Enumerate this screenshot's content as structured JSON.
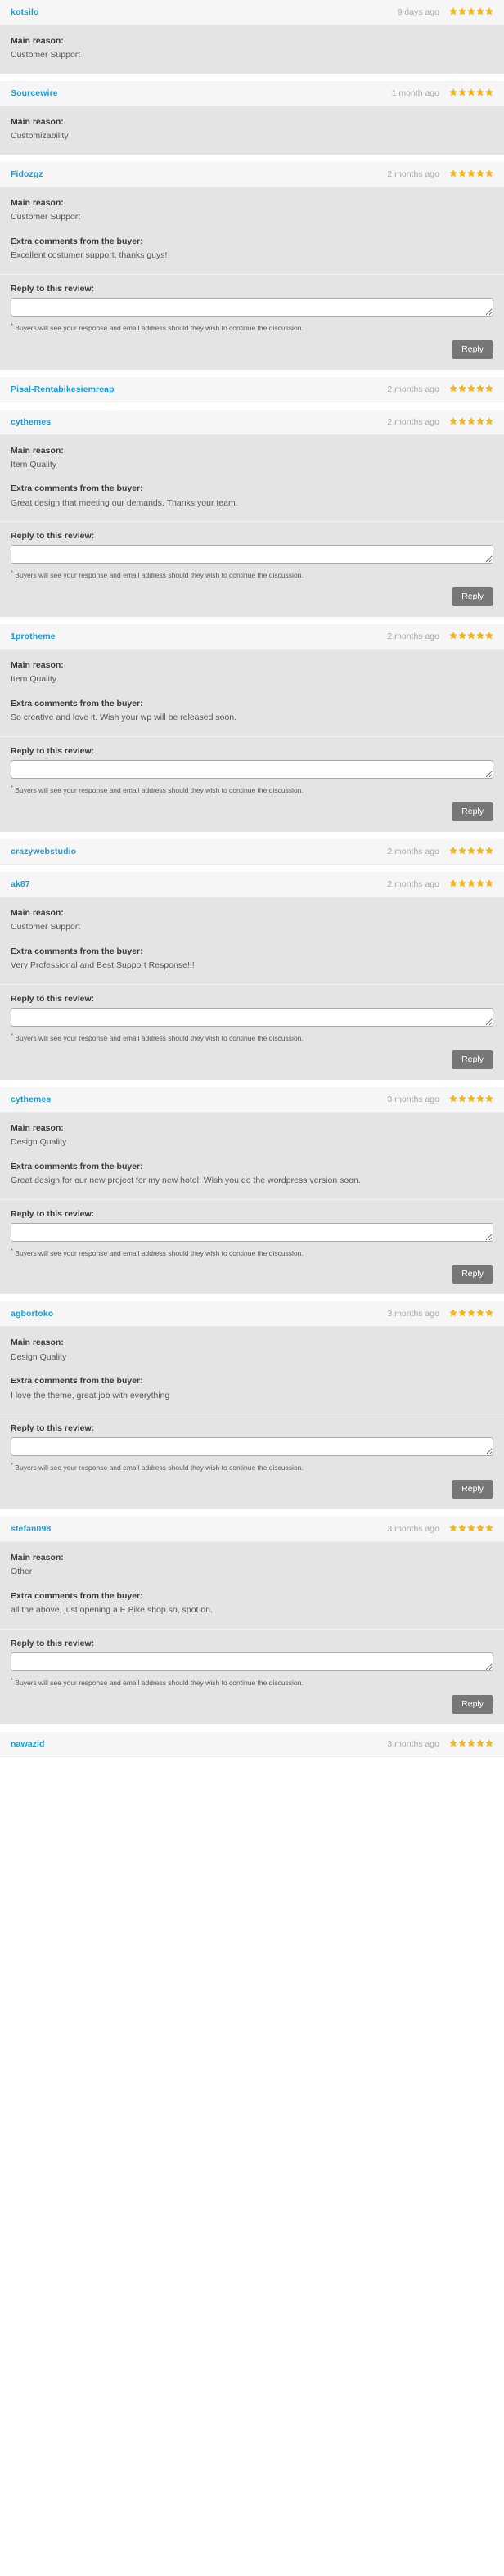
{
  "colors": {
    "link": "#1b9bd8",
    "star": "#f5b714",
    "header_bg": "#f6f6f6",
    "body_bg": "#e4e4e4",
    "button_bg": "#777777",
    "date_text": "#a8a8a8",
    "body_text": "#58585a"
  },
  "labels": {
    "main_reason": "Main reason:",
    "extra_comments": "Extra comments from the buyer:",
    "reply_to_review": "Reply to this review:",
    "reply_note": "Buyers will see your response and email address should they wish to continue the discussion.",
    "reply_button": "Reply",
    "reply_placeholder": ""
  },
  "reviews": [
    {
      "username": "kotsilo",
      "date": "9 days ago",
      "rating": 5,
      "main_reason": "Customer Support",
      "extra_comments": null,
      "has_reply_form": false
    },
    {
      "username": "Sourcewire",
      "date": "1 month ago",
      "rating": 5,
      "main_reason": "Customizability",
      "extra_comments": null,
      "has_reply_form": false
    },
    {
      "username": "Fidozgz",
      "date": "2 months ago",
      "rating": 5,
      "main_reason": "Customer Support",
      "extra_comments": "Excellent costumer support, thanks guys!",
      "has_reply_form": true
    },
    {
      "username": "Pisal-Rentabikesiemreap",
      "date": "2 months ago",
      "rating": 5,
      "main_reason": null,
      "extra_comments": null,
      "has_reply_form": false
    },
    {
      "username": "cythemes",
      "date": "2 months ago",
      "rating": 5,
      "main_reason": "Item Quality",
      "extra_comments": "Great design that meeting our demands. Thanks your team.",
      "has_reply_form": true
    },
    {
      "username": "1protheme",
      "date": "2 months ago",
      "rating": 5,
      "main_reason": "Item Quality",
      "extra_comments": "So creative and love it. Wish your wp will be released soon.",
      "has_reply_form": true
    },
    {
      "username": "crazywebstudio",
      "date": "2 months ago",
      "rating": 5,
      "main_reason": null,
      "extra_comments": null,
      "has_reply_form": false
    },
    {
      "username": "ak87",
      "date": "2 months ago",
      "rating": 5,
      "main_reason": "Customer Support",
      "extra_comments": "Very Professional and Best Support Response!!!",
      "has_reply_form": true
    },
    {
      "username": "cythemes",
      "date": "3 months ago",
      "rating": 5,
      "main_reason": "Design Quality",
      "extra_comments": "Great design for our new project for my new hotel. Wish you do the wordpress version soon.",
      "has_reply_form": true
    },
    {
      "username": "agbortoko",
      "date": "3 months ago",
      "rating": 5,
      "main_reason": "Design Quality",
      "extra_comments": "I love the theme, great job with everything",
      "has_reply_form": true
    },
    {
      "username": "stefan098",
      "date": "3 months ago",
      "rating": 5,
      "main_reason": "Other",
      "extra_comments": "all the above, just opening a E Bike shop so, spot on.",
      "has_reply_form": true
    },
    {
      "username": "nawazid",
      "date": "3 months ago",
      "rating": 5,
      "main_reason": null,
      "extra_comments": null,
      "has_reply_form": false
    }
  ]
}
